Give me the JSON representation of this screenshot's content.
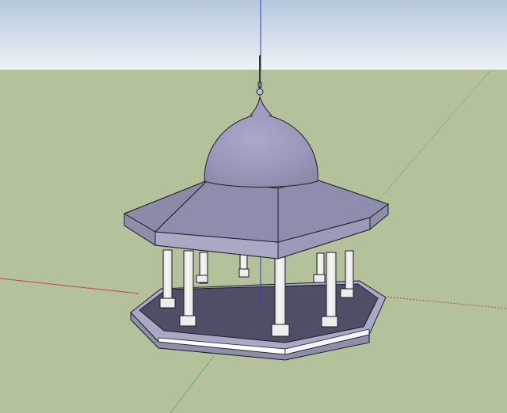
{
  "scene": {
    "colors": {
      "sky_top": "#b6c7dc",
      "sky_bottom": "#eef2f6",
      "ground": "#b4c29b",
      "red_axis": "#c7462f",
      "green_axis": "#65b65a",
      "blue_axis": "#3239c4",
      "face_front": "#a9a8c5",
      "face_side": "#9b9bb9",
      "face_top": "#8b8aa9",
      "dome": "#9f9ec0",
      "floor_shadow": "#4f4e67",
      "column": "#eeeeee",
      "edge": "#1f1f27"
    },
    "objects": [
      "gazebo",
      "dome",
      "finial",
      "octagonal-roof",
      "columns",
      "octagonal-base"
    ]
  }
}
